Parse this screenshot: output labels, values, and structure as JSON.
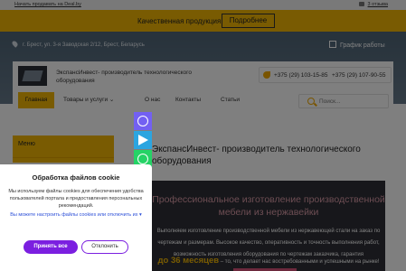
{
  "topbar": {
    "sell_link": "Начать продавать на Deal.by",
    "reviews_link": "3 отзыва"
  },
  "promo": {
    "text": "Качественная продукция",
    "button": "Подробнее"
  },
  "header": {
    "address": "г. Брест, ул. 3-я Заводская 2/12, Брест, Беларусь",
    "schedule": "График работы",
    "company_name": "ЭкспансИнвест- производитель технологического оборудования",
    "phones": [
      "+375 (29) 103-15-85",
      "+375 (29) 107-90-55"
    ]
  },
  "nav": {
    "home": "Главная",
    "services": "Товары и услуги",
    "about": "О нас",
    "contacts": "Контакты",
    "articles": "Статьи"
  },
  "search": {
    "placeholder": "Поиск..."
  },
  "sidebar": {
    "menu_label": "Меню"
  },
  "page": {
    "title": "ЭкспансИнвест- производитель технологического оборудования"
  },
  "banner": {
    "headline": "Профессиональное изготовление производственной мебели из нержавейки",
    "body": "Выполняем изготовление производственной мебели из нержавеющей стали на заказ по чертежам и размерам. Высокое качество, оперативность и точность выполнения работ, возможность изготовления оборудования по чертежам заказчика, гарантия",
    "guarantee_value": "до 36 месяцев",
    "guarantee_tail": "– то, что делает нас востребованными и успешными на рынке!"
  },
  "cookie": {
    "title": "Обработка файлов cookie",
    "text": "Мы используем файлы cookies для обеспечения удобства пользователей портала и предоставления персональных рекомендаций.",
    "link": "Вы можете настроить файлы cookies или отключить их ▾",
    "accept": "Принять все",
    "decline": "Отклонить"
  },
  "colors": {
    "accent": "#f2b705",
    "cookie_accent": "#7b1fe0",
    "banner_bg": "#2e2f36"
  }
}
